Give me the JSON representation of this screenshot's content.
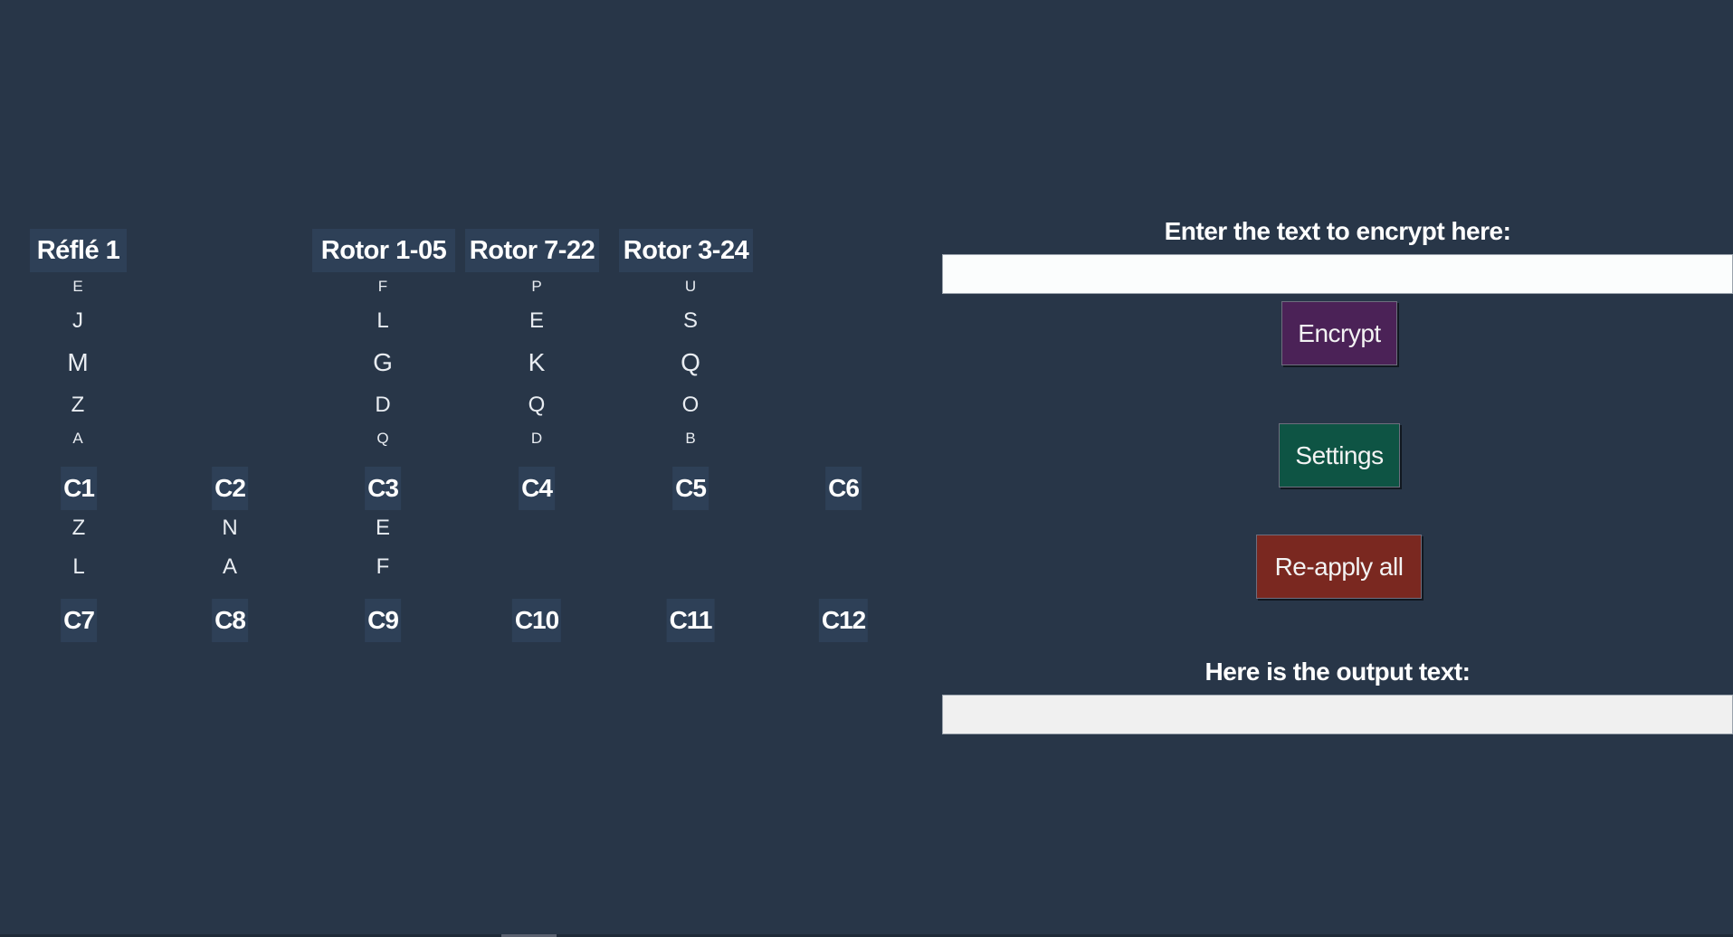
{
  "rotor_headers": [
    "Réflé 1",
    "Rotor 1-05",
    "Rotor 7-22",
    "Rotor 3-24"
  ],
  "rotor_columns": {
    "reflector": [
      "E",
      "J",
      "M",
      "Z",
      "A"
    ],
    "rotor_1": [
      "F",
      "L",
      "G",
      "D",
      "Q"
    ],
    "rotor_2": [
      "P",
      "E",
      "K",
      "Q",
      "D"
    ],
    "rotor_3": [
      "U",
      "S",
      "Q",
      "O",
      "B"
    ]
  },
  "plugboard": {
    "row1_labels": [
      "C1",
      "C2",
      "C3",
      "C4",
      "C5",
      "C6"
    ],
    "row1_values": [
      [
        "Z",
        "L"
      ],
      [
        "N",
        "A"
      ],
      [
        "E",
        "F"
      ],
      [],
      [],
      []
    ],
    "row2_labels": [
      "C7",
      "C8",
      "C9",
      "C10",
      "C11",
      "C12"
    ]
  },
  "input": {
    "label": "Enter the text to encrypt here:",
    "value": "",
    "placeholder": ""
  },
  "buttons": {
    "encrypt": "Encrypt",
    "settings": "Settings",
    "reapply": "Re-apply all"
  },
  "output": {
    "label": "Here is the output text:",
    "value": ""
  },
  "colors": {
    "background": "#283648",
    "header_cell": "#2e4057",
    "encrypt_button": "#4b2257",
    "settings_button": "#0e5444",
    "reapply_button": "#7a2820"
  }
}
